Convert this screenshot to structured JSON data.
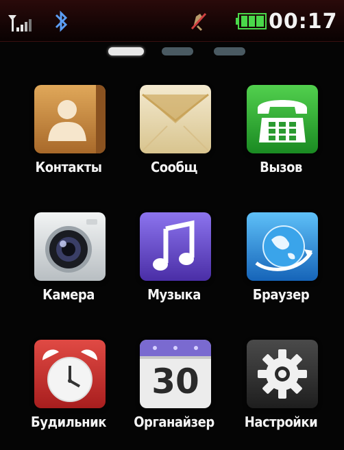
{
  "status": {
    "time": "00:17",
    "signal_icon": "signal-strength-icon",
    "bluetooth_icon": "bluetooth-icon",
    "silent_icon": "silent-mode-icon",
    "battery_icon": "battery-full-icon"
  },
  "pager": {
    "pages": 3,
    "active_page": 1
  },
  "apps": [
    {
      "label": "Контакты",
      "icon": "contacts-icon"
    },
    {
      "label": "Сообщ",
      "icon": "messages-icon"
    },
    {
      "label": "Вызов",
      "icon": "call-icon"
    },
    {
      "label": "Камера",
      "icon": "camera-icon"
    },
    {
      "label": "Музыка",
      "icon": "music-icon"
    },
    {
      "label": "Браузер",
      "icon": "browser-icon"
    },
    {
      "label": "Будильник",
      "icon": "alarm-clock-icon"
    },
    {
      "label": "Органайзер",
      "icon": "organizer-calendar-icon",
      "badge": "30"
    },
    {
      "label": "Настройки",
      "icon": "settings-gear-icon"
    }
  ],
  "colors": {
    "contacts": "#c98a3a",
    "messages": "#e8d9b4",
    "call": "#2fae3c",
    "camera": "#d9dde0",
    "music": "#6a4fc9",
    "browser": "#2f8fd8",
    "alarm": "#c83232",
    "organizer": "#e6e6e6",
    "settings": "#2c2c2c"
  }
}
